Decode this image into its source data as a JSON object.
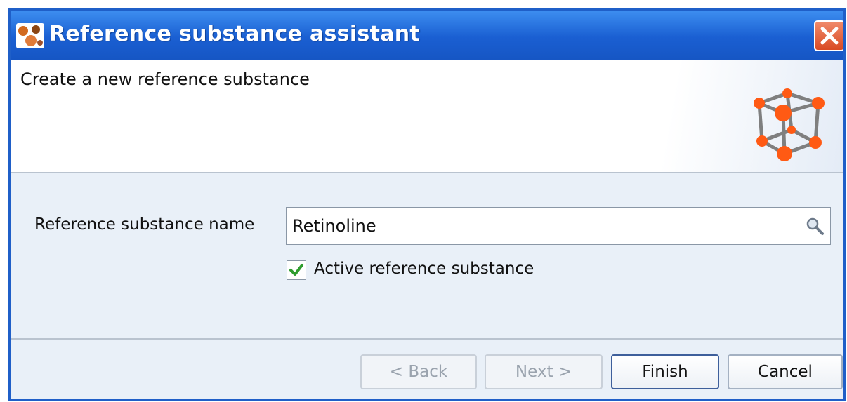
{
  "window": {
    "title": "Reference substance assistant",
    "app_icon": "app-logo-icon",
    "close_icon": "close-icon"
  },
  "header": {
    "text": "Create a new reference substance",
    "icon": "molecule-cube-icon"
  },
  "form": {
    "name_label": "Reference substance name",
    "name_value": "Retinoline",
    "search_icon": "search-icon",
    "active_label": "Active reference substance",
    "active_checked": true
  },
  "buttons": {
    "back": "< Back",
    "next": "Next >",
    "finish": "Finish",
    "cancel": "Cancel"
  },
  "colors": {
    "titlebar": "#1a5fd2",
    "close": "#d94a24",
    "atom": "#ff5a14",
    "check": "#2e9c2e"
  }
}
